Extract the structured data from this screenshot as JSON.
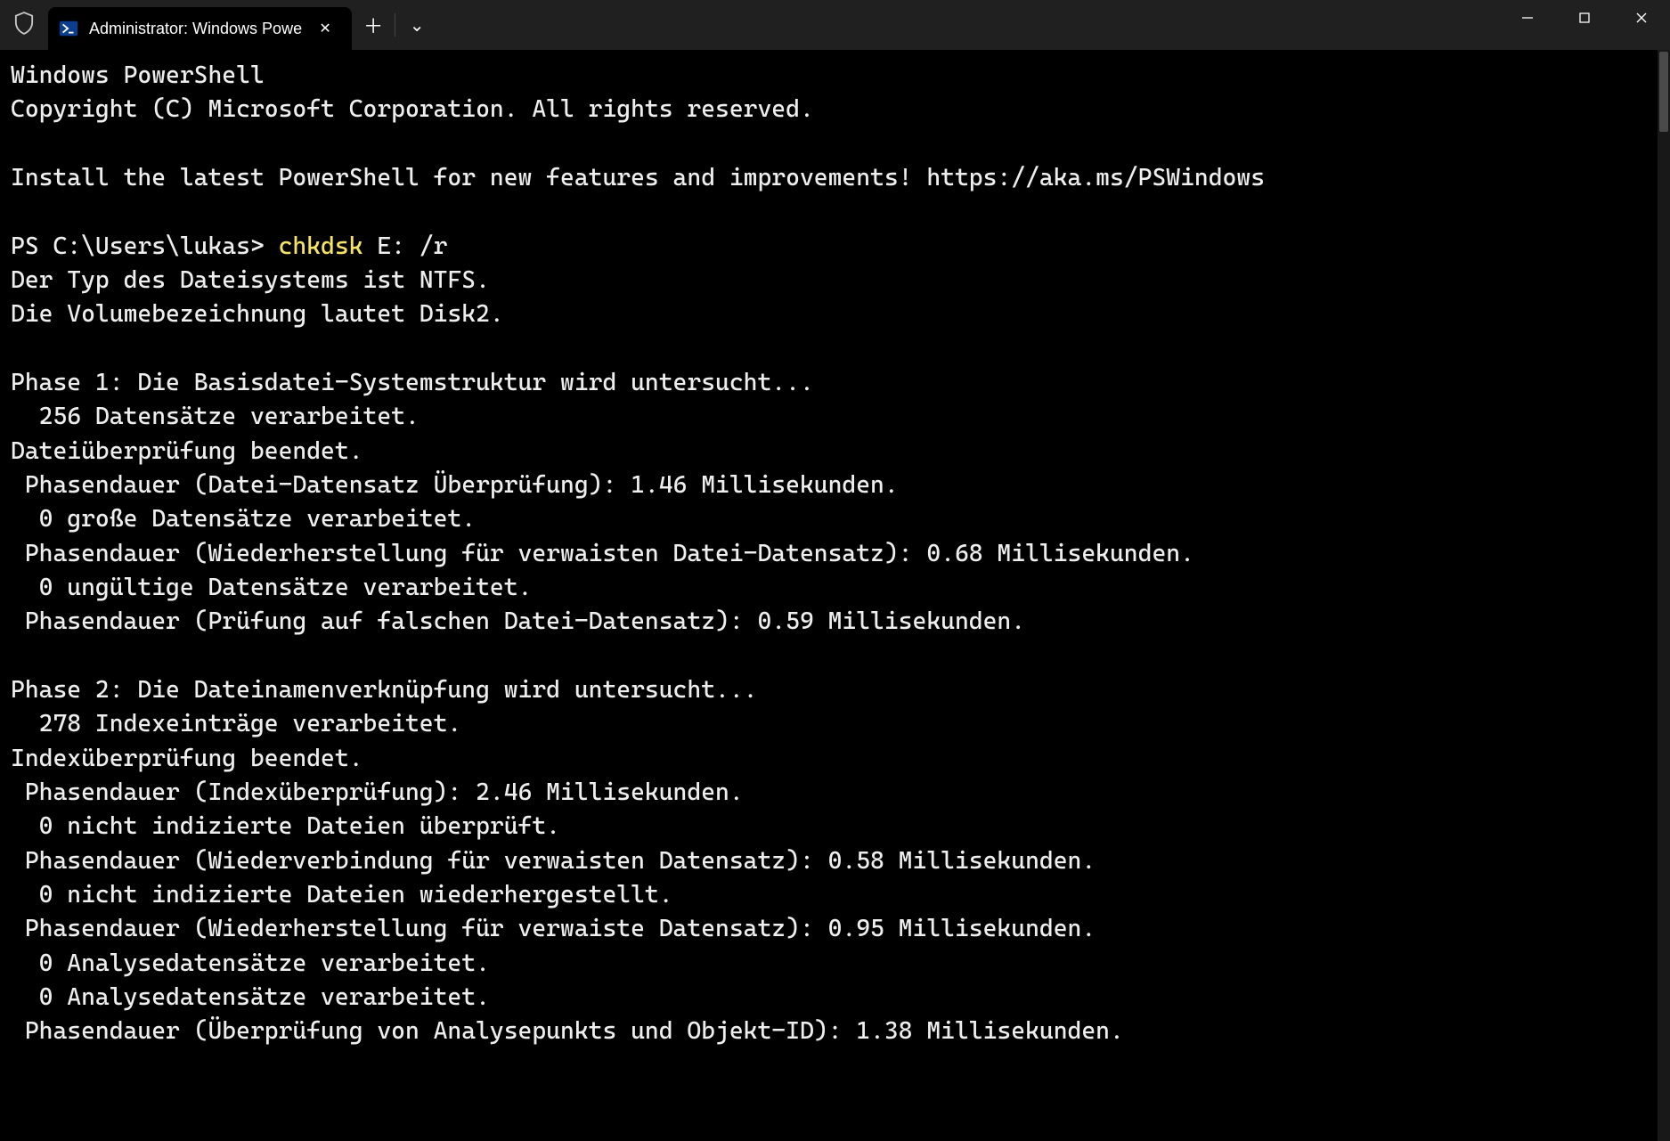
{
  "titlebar": {
    "tab_title": "Administrator: Windows Powe",
    "close_glyph": "✕",
    "newtab_glyph": "＋",
    "dropdown_glyph": "⌄"
  },
  "terminal": {
    "prompt_part1": "PS C:\\Users\\lukas> ",
    "cmd_highlight": "chkdsk",
    "cmd_rest": " E: /r",
    "lines_before_prompt": [
      "Windows PowerShell",
      "Copyright (C) Microsoft Corporation. All rights reserved.",
      "",
      "Install the latest PowerShell for new features and improvements! https://aka.ms/PSWindows",
      ""
    ],
    "lines_after_prompt": [
      "Der Typ des Dateisystems ist NTFS.",
      "Die Volumebezeichnung lautet Disk2.",
      "",
      "Phase 1: Die Basisdatei-Systemstruktur wird untersucht...",
      "  256 Datensätze verarbeitet.",
      "Dateiüberprüfung beendet.",
      " Phasendauer (Datei-Datensatz Überprüfung): 1.46 Millisekunden.",
      "  0 große Datensätze verarbeitet.",
      " Phasendauer (Wiederherstellung für verwaisten Datei-Datensatz): 0.68 Millisekunden.",
      "  0 ungültige Datensätze verarbeitet.",
      " Phasendauer (Prüfung auf falschen Datei-Datensatz): 0.59 Millisekunden.",
      "",
      "Phase 2: Die Dateinamenverknüpfung wird untersucht...",
      "  278 Indexeinträge verarbeitet.",
      "Indexüberprüfung beendet.",
      " Phasendauer (Indexüberprüfung): 2.46 Millisekunden.",
      "  0 nicht indizierte Dateien überprüft.",
      " Phasendauer (Wiederverbindung für verwaisten Datensatz): 0.58 Millisekunden.",
      "  0 nicht indizierte Dateien wiederhergestellt.",
      " Phasendauer (Wiederherstellung für verwaiste Datensatz): 0.95 Millisekunden.",
      "  0 Analysedatensätze verarbeitet.",
      "  0 Analysedatensätze verarbeitet.",
      " Phasendauer (Überprüfung von Analysepunkts und Objekt-ID): 1.38 Millisekunden."
    ]
  },
  "colors": {
    "bg_titlebar": "#202020",
    "bg_terminal": "#000000",
    "cmd_highlight": "#f5e368",
    "text": "#eeeeee"
  }
}
